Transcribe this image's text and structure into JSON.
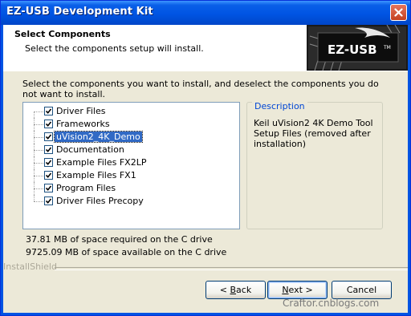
{
  "window": {
    "title": "EZ-USB Development Kit",
    "close_icon": "close-icon"
  },
  "header": {
    "title": "Select Components",
    "subtitle": "Select the components setup will install.",
    "logo_text": "EZ-USB",
    "logo_tm": "TM"
  },
  "instruction": "Select the components you want to install, and deselect the components you do not want to install.",
  "components": [
    {
      "label": "Driver Files",
      "checked": true,
      "selected": false
    },
    {
      "label": "Frameworks",
      "checked": true,
      "selected": false
    },
    {
      "label": "uVision2_4K_Demo",
      "checked": true,
      "selected": true
    },
    {
      "label": "Documentation",
      "checked": true,
      "selected": false
    },
    {
      "label": "Example Files FX2LP",
      "checked": true,
      "selected": false
    },
    {
      "label": "Example Files FX1",
      "checked": true,
      "selected": false
    },
    {
      "label": "Program Files",
      "checked": true,
      "selected": false
    },
    {
      "label": "Driver Files Precopy",
      "checked": true,
      "selected": false
    }
  ],
  "description": {
    "legend": "Description",
    "text": "Keil uVision2 4K Demo Tool Setup Files (removed after installation)"
  },
  "space": {
    "required": "37.81 MB of space required on the C drive",
    "available": "9725.09 MB of space available on the C drive"
  },
  "installshield_label": "InstallShield",
  "buttons": {
    "back_prefix": "< ",
    "back_mnemonic": "B",
    "back_rest": "ack",
    "next_mnemonic": "N",
    "next_rest": "ext >",
    "cancel": "Cancel"
  },
  "watermark": "Craftor.cnblogs.com",
  "colors": {
    "title_bar": "#0054e3",
    "selection": "#316ac5",
    "legend": "#0046d5",
    "dialog_bg": "#ece9d8"
  }
}
